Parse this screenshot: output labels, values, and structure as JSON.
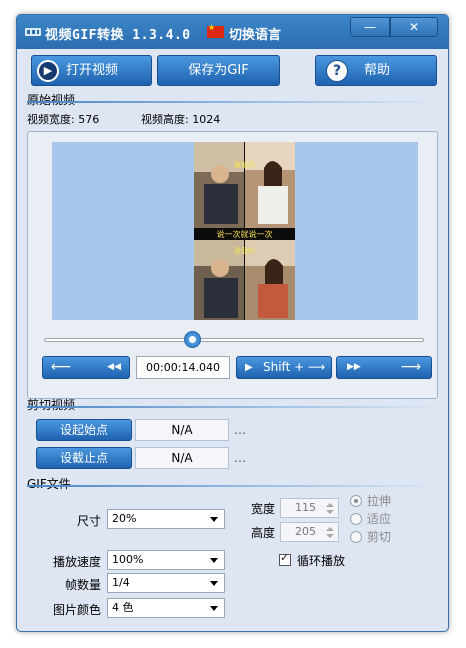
{
  "titlebar": {
    "title": "视频GIF转换 1.3.4.0",
    "language_label": "切换语言",
    "minimize_glyph": "—",
    "close_glyph": "✕"
  },
  "toolbar": {
    "open_label": "打开视频",
    "save_label": "保存为GIF",
    "help_label": "帮助"
  },
  "source": {
    "section_label": "原始视频",
    "width_text": "视频宽度: 576",
    "height_text": "视频高度: 1024",
    "preview": {
      "caption_top": "被偷内",
      "caption_mid": "说一次就说一次",
      "caption_bottom": "是我的"
    },
    "slider": {
      "position_fraction": 0.39
    },
    "controls": {
      "prev_glyph": "⟵",
      "rewind_glyph": "◀◀",
      "time": "00:00:14.040",
      "play_label": "Shift + ⟶",
      "forward_glyph": "▶▶",
      "next_glyph": "⟶"
    }
  },
  "cut": {
    "section_label": "剪切视频",
    "start_label": "设起始点",
    "end_label": "设截止点",
    "start_value": "N/A",
    "end_value": "N/A",
    "ellipsis": "…"
  },
  "gif": {
    "section_label": "GIF文件",
    "size_label": "尺寸",
    "size_value": "20%",
    "width_label": "宽度",
    "width_value": "115",
    "height_label": "高度",
    "height_value": "205",
    "fit_options": [
      "拉伸",
      "适应",
      "剪切"
    ],
    "fit_selected_index": 0,
    "speed_label": "播放速度",
    "speed_value": "100%",
    "frames_label": "帧数量",
    "frames_value": "1/4",
    "colors_label": "图片颜色",
    "colors_value": "4 色",
    "loop_label": "循环播放",
    "loop_checked": true
  },
  "colors": {
    "accent_blue": "#2a6db0",
    "preview_bg": "#a8c7ea",
    "window_bg": "#dde6f2"
  }
}
